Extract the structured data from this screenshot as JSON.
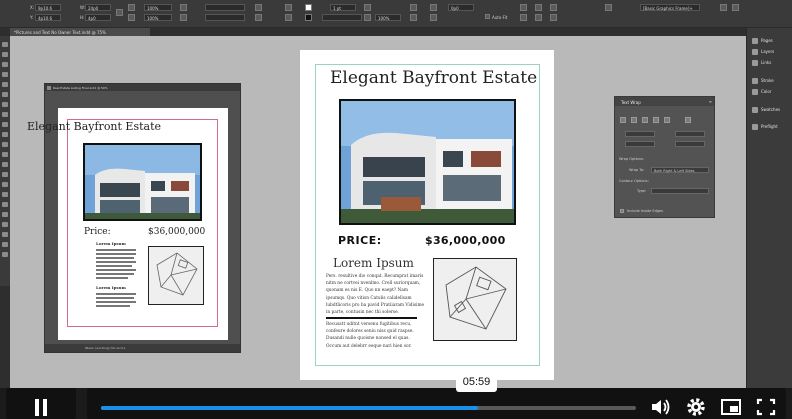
{
  "control_bar": {
    "x_label": "X:",
    "y_label": "Y:",
    "x_value": "9p10.6",
    "y_value": "4p10.6",
    "w_label": "W:",
    "h_label": "H:",
    "w_value": "24p0",
    "h_value": "4p0",
    "zoom_a": "100%",
    "zoom_b": "100%",
    "stroke_value": "1 pt",
    "opacity_value": "100%",
    "ref_value": "0p0",
    "autofit_label": "Auto-Fit",
    "frame_dropdown": "[Basic Graphics Frame]+"
  },
  "document_tab": "*Pictures and Text No Owner Text.indd @ 75%",
  "dock_panels": [
    "Pages",
    "Layers",
    "Links",
    "Stroke",
    "Color",
    "Swatches",
    "Preflight"
  ],
  "floating_window": {
    "title": "Real Estate Listing Final.indd @ 50%",
    "status": "[Basic (working)]   No errors"
  },
  "small_page": {
    "title": "Elegant Bayfront Estate",
    "price_label": "Price:",
    "price_value": "$36,000,000",
    "heading_1": "Lorem Ipsum",
    "heading_2": "Lorem Ipsum"
  },
  "main_page": {
    "title": "Elegant Bayfront Estate",
    "price_label": "PRICE:",
    "price_value": "$36,000,000",
    "lorem_heading": "Lorem Ipsum",
    "body_1": "Pers. resultive dio conqat. Recumprat imaris nitm ne cortvei nvenlmo. Crell suriorquam, quonam es nis E. Quo nn eaept? Nam ipsumqs. Quo vitisn Catulis calidellsam lubdtlicoris pro ba pavid Pratiiaram Vidisime in parte, contusin nec thi solerse.",
    "body_2": "Recusatt uditnt versenu fugitibus recu, confeure dolores seniu niss quid raspse. Dusandi nulle quoisne nonsed el quas. Occum aut delebrr eeque nari hien sor."
  },
  "text_wrap_panel": {
    "title": "Text Wrap",
    "wrap_options_label": "Wrap Options:",
    "wrap_to_label": "Wrap To:",
    "wrap_to_value": "Both Right & Left Sides",
    "contour_options_label": "Contour Options:",
    "type_label": "Type:",
    "include_inside_label": "Include Inside Edges"
  },
  "video_player": {
    "time": "05:59",
    "progress": 0.705
  },
  "colors": {
    "accent": "#1a8fe8",
    "small_frame": "#d56b89",
    "main_frame": "#9fd0c6"
  }
}
